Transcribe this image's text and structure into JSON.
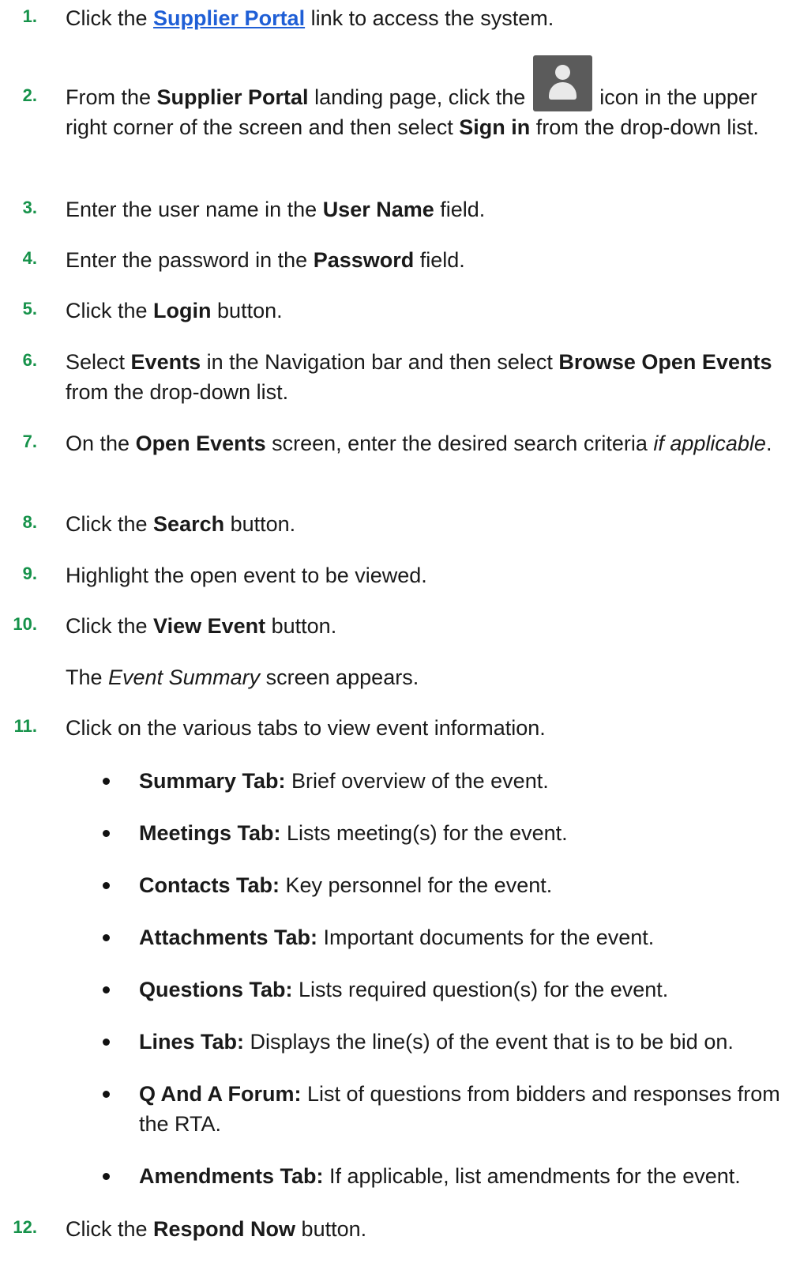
{
  "steps": [
    {
      "num": "1.",
      "pre": "Click the ",
      "link": "Supplier Portal",
      "post": " link to access the system."
    },
    {
      "num": "2.",
      "t1": "From the ",
      "b1": "Supplier Portal",
      "t2": " landing page, click the ",
      "icon": "user-avatar-icon",
      "t3": " icon in the upper right corner of the screen and then select ",
      "b2": "Sign in",
      "t4": " from the drop-down list."
    },
    {
      "num": "3.",
      "t1": "Enter the user name in the ",
      "b1": "User Name",
      "t2": " field."
    },
    {
      "num": "4.",
      "t1": "Enter the password in the ",
      "b1": "Password",
      "t2": " field."
    },
    {
      "num": "5.",
      "t1": "Click the ",
      "b1": "Login",
      "t2": " button."
    },
    {
      "num": "6.",
      "t1": "Select ",
      "b1": "Events",
      "t2": " in the Navigation bar and then select ",
      "b2": "Browse Open Events",
      "t3": " from the drop-down list."
    },
    {
      "num": "7.",
      "t1": "On the ",
      "b1": "Open Events",
      "t2": " screen, enter the desired search criteria ",
      "i1": "if applicable",
      "t3": "."
    },
    {
      "num": "8.",
      "t1": "Click the ",
      "b1": "Search",
      "t2": " button."
    },
    {
      "num": "9.",
      "t1": "Highlight the open event to be viewed."
    },
    {
      "num": "10.",
      "t1": "Click the ",
      "b1": "View Event",
      "t2": " button."
    },
    {
      "note_t1": "The ",
      "note_i1": "Event Summary",
      "note_t2": " screen appears."
    },
    {
      "num": "11.",
      "t1": "Click on the various tabs to view event information."
    },
    {
      "num": "12.",
      "t1": "Click the ",
      "b1": "Respond Now",
      "t2": " button."
    }
  ],
  "tabs": [
    {
      "label": "Summary Tab:",
      "desc": " Brief overview of the event."
    },
    {
      "label": "Meetings Tab:",
      "desc": " Lists meeting(s) for the event."
    },
    {
      "label": "Contacts Tab:",
      "desc": " Key personnel for the event."
    },
    {
      "label": "Attachments Tab:",
      "desc": " Important documents for the event."
    },
    {
      "label": "Questions Tab:",
      "desc": " Lists required question(s) for the event."
    },
    {
      "label": "Lines Tab:",
      "desc": " Displays the line(s) of the event that is to be bid on."
    },
    {
      "label": "Q And A Forum:",
      "desc": " List of questions from bidders and responses from the RTA."
    },
    {
      "label": "Amendments Tab:",
      "desc": " If applicable, list amendments for the event."
    }
  ],
  "colors": {
    "step_number": "#16924a",
    "link": "#1f5fd6",
    "avatar_bg": "#5b5b5b"
  }
}
